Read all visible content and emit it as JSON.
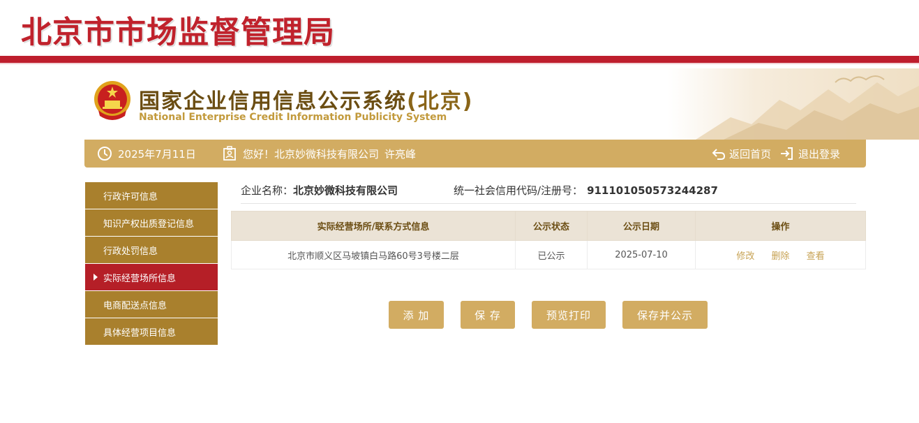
{
  "header": {
    "bureau_title": "北京市市场监督管理局",
    "system_title": "国家企业信用信息公示系统",
    "system_region": "(北京)",
    "system_subtitle": "National Enterprise Credit Information Publicity System"
  },
  "infobar": {
    "date": "2025年7月11日",
    "greeting": "您好！北京妙微科技有限公司",
    "user_name": "许亮峰",
    "back_home": "返回首页",
    "logout": "退出登录"
  },
  "sidebar": {
    "items": [
      {
        "label": "行政许可信息",
        "active": false
      },
      {
        "label": "知识产权出质登记信息",
        "active": false
      },
      {
        "label": "行政处罚信息",
        "active": false
      },
      {
        "label": "实际经营场所信息",
        "active": true
      },
      {
        "label": "电商配送点信息",
        "active": false
      },
      {
        "label": "具体经营项目信息",
        "active": false
      }
    ]
  },
  "company": {
    "name_label": "企业名称：",
    "name_value": "北京妙微科技有限公司",
    "credit_label": "统一社会信用代码/注册号：",
    "credit_value": "911101050573244287"
  },
  "table": {
    "headers": [
      "实际经营场所/联系方式信息",
      "公示状态",
      "公示日期",
      "操作"
    ],
    "rows": [
      {
        "address": "北京市顺义区马坡镇白马路60号3号楼二层",
        "status": "已公示",
        "date": "2025-07-10",
        "ops": [
          "修改",
          "删除",
          "查看"
        ]
      }
    ]
  },
  "actions": {
    "add": "添 加",
    "save": "保 存",
    "preview_print": "预览打印",
    "save_publish": "保存并公示"
  },
  "colors": {
    "brand_red": "#be1e2d",
    "gold": "#d2ac62",
    "sidebar_gold": "#a9802d",
    "active_red": "#b51f27"
  }
}
